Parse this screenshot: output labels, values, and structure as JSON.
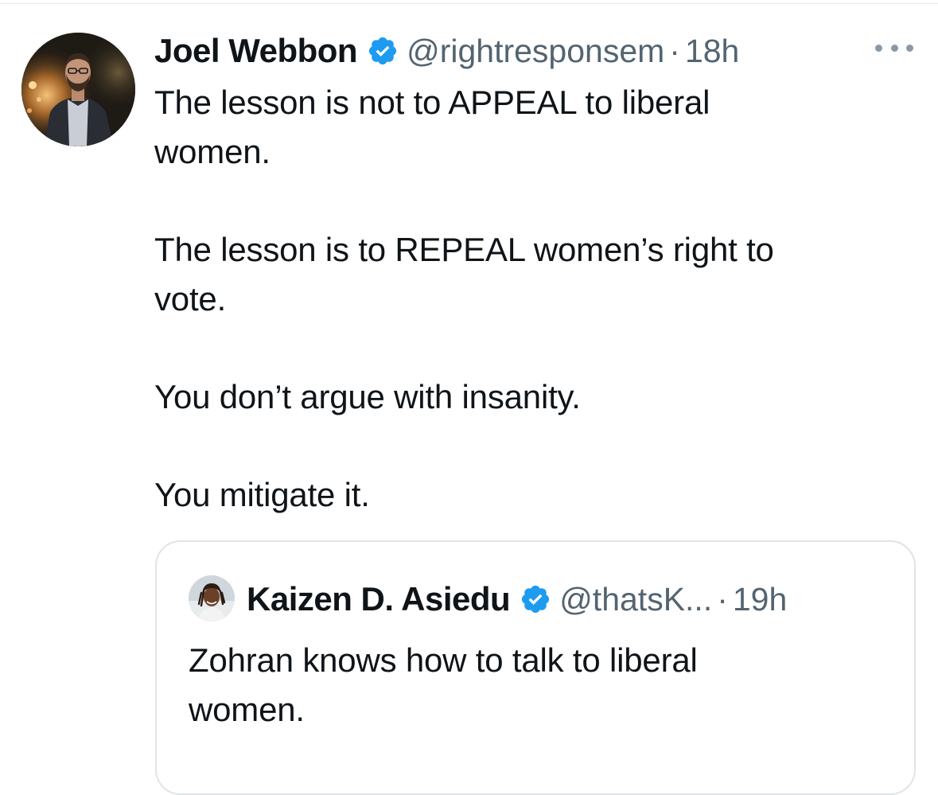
{
  "tweet": {
    "author_name": "Joel Webbon",
    "handle": "@rightresponsem",
    "separator": "·",
    "time": "18h",
    "avatar_icon": "profile-photo-man-in-suit",
    "verified_icon": "verified-badge-icon",
    "more_icon": "more-options-icon",
    "text_lines": [
      "The lesson is not to APPEAL to liberal",
      "women.",
      "The lesson is to REPEAL women’s right to",
      "vote.",
      "You don’t argue with insanity.",
      "You mitigate it."
    ]
  },
  "quote": {
    "author_name": "Kaizen D. Asiedu",
    "handle": "@thatsK...",
    "separator": "·",
    "time": "19h",
    "avatar_icon": "profile-photo-man-with-locs",
    "verified_icon": "verified-badge-icon",
    "text_lines": [
      "Zohran knows how to talk to liberal",
      "women."
    ]
  },
  "colors": {
    "text_primary": "#0f1419",
    "text_secondary": "#536471",
    "verified_blue": "#1d9bf0",
    "border": "#dfe4e8"
  }
}
